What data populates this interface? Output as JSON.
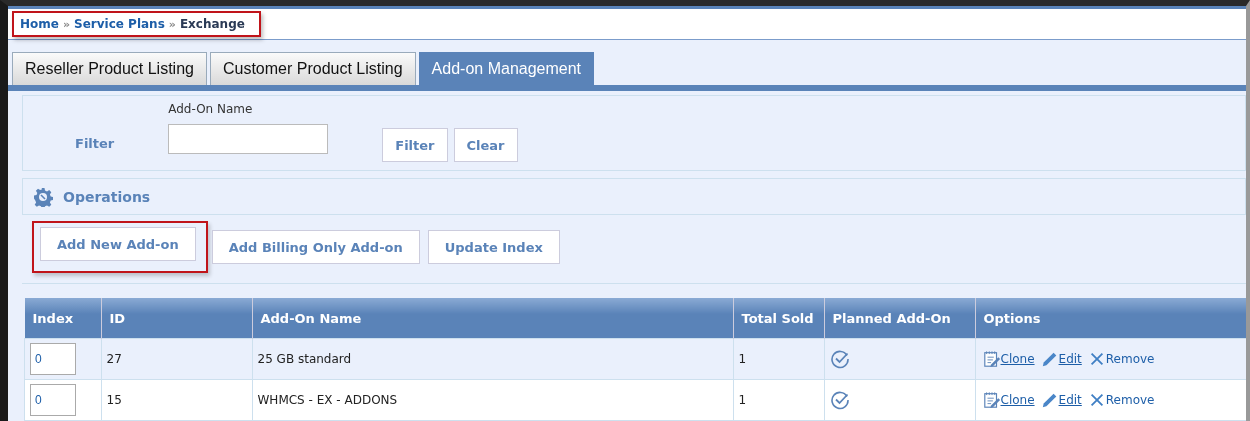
{
  "breadcrumb": [
    {
      "label": "Home",
      "link": true
    },
    {
      "label": "Service Plans",
      "link": true
    },
    {
      "label": "Exchange",
      "link": false
    }
  ],
  "breadcrumb_separator": "»",
  "tabs": [
    {
      "label": "Reseller Product Listing",
      "selected": false
    },
    {
      "label": "Customer Product Listing",
      "selected": false
    },
    {
      "label": "Add-on Management",
      "selected": true
    }
  ],
  "filter": {
    "label": "Filter",
    "field_label": "Add-On Name",
    "buttons": [
      "Filter",
      "Clear"
    ]
  },
  "operations": {
    "title": "Operations",
    "buttons": [
      {
        "label": "Add New Add-on",
        "highlighted": true
      },
      {
        "label": "Add Billing Only Add-on",
        "highlighted": false
      },
      {
        "label": "Update Index",
        "highlighted": false
      }
    ]
  },
  "table": {
    "columns": [
      "Index",
      "ID",
      "Add-On Name",
      "Total Sold",
      "Planned Add-On",
      "Options"
    ],
    "rows": [
      {
        "index": "0",
        "id": "27",
        "name": "25 GB standard",
        "total_sold": "1",
        "planned": true,
        "options": [
          "Clone",
          "Edit",
          "Remove"
        ]
      },
      {
        "index": "0",
        "id": "15",
        "name": "WHMCS - EX - ADDONS",
        "total_sold": "1",
        "planned": true,
        "options": [
          "Clone",
          "Edit",
          "Remove"
        ]
      }
    ]
  }
}
